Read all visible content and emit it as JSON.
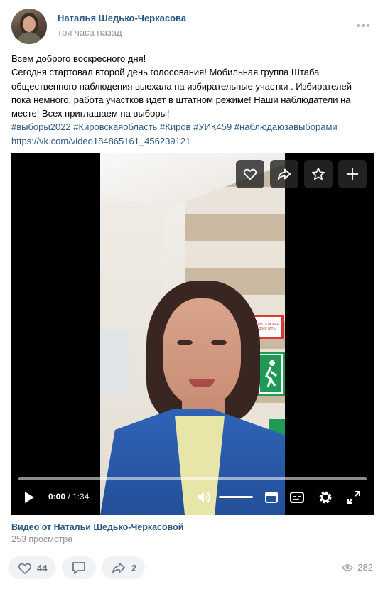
{
  "post": {
    "author": "Наталья Шедько-Черкасова",
    "time": "три часа назад",
    "text_lines": [
      "Всем доброго воскресного дня!",
      "Сегодня стартовал второй день голосования! Мобильная группа Штаба",
      "общественного наблюдения выехала на избирательные участки . Избирателей",
      "пока немного, работа участков идет в штатном режиме! Наши наблюдатели на",
      "месте! Всех приглашаем на выборы!"
    ],
    "hashtags": "#выборы2022 #Кировскаяобласть #Киров #УИК459 #наблюдаюзавыборами",
    "link": "https://vk.com/video184865161_456239121"
  },
  "video": {
    "current_time": "0:00",
    "separator": " / ",
    "duration": "1:34",
    "progress_fraction": 0,
    "volume_fraction": 1,
    "sign_text": "ПРИ ПОЖАРЕ ЗВОНИТЬ",
    "title": "Видео от Натальи Шедько-Черкасовой",
    "views_label": "253 просмотра"
  },
  "actions": {
    "likes": "44",
    "reposts": "2",
    "views": "282"
  },
  "colors": {
    "link": "#2a5885",
    "muted": "#939393",
    "action_bg": "#f0f2f5"
  },
  "icons": [
    "more-icon",
    "heart-icon",
    "share-icon",
    "star-icon",
    "plus-icon",
    "play-icon",
    "volume-icon",
    "miniplayer-icon",
    "subtitles-icon",
    "settings-icon",
    "fullscreen-icon",
    "comment-icon",
    "eye-icon"
  ]
}
